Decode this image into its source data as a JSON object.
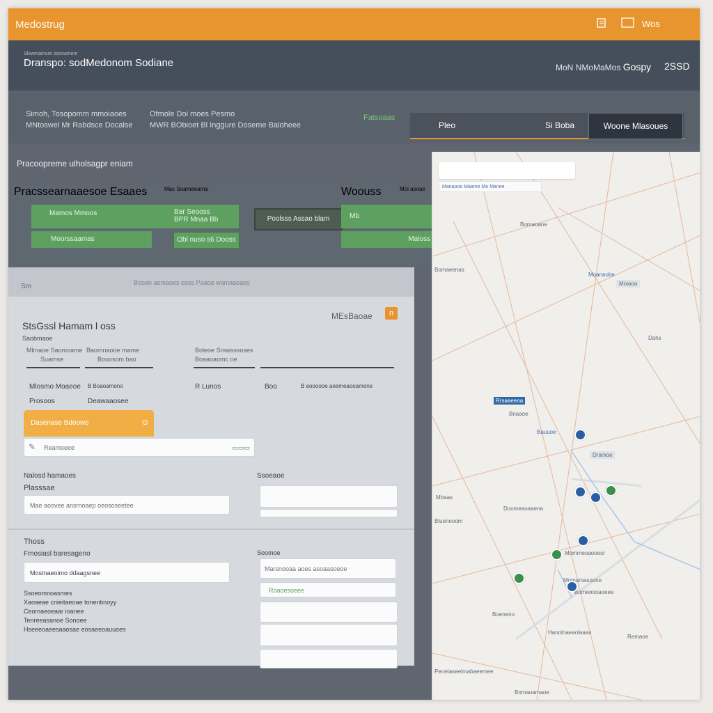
{
  "app": {
    "brand": "Medostrug",
    "topbar_label": "Wos",
    "topbar_icons": [
      "notes-icon",
      "window-icon"
    ]
  },
  "header": {
    "small_text": "Slowmamore ozonamem",
    "title": "Dranspo: sodMedonom Sodiane",
    "meta": "MoN NMoMaMos",
    "meta_value": "Gospy",
    "number": "2SSD"
  },
  "subheader": {
    "col1": [
      "Simoh, Tosopomm mmoiaoes",
      "MNtoswel Mr Rabdsce Docalse"
    ],
    "col2": [
      "Ofmole Doi moes Pesmo",
      "MWR BObioet Bl Inggure Doseme Baloheee"
    ],
    "status": "Fatsoaas"
  },
  "tabs": [
    "Pleo",
    "Si Boba",
    "Woone  Mlasoues"
  ],
  "section": {
    "title": "Pracoopreme ulholsagpr eniam",
    "labels": [
      "Pracssearnaaesoe Esaaes",
      "Mac Soameeama",
      "Woouss",
      "Moi asoae"
    ],
    "btn1": "Mamos Mmoos",
    "btn1_sub": "Moorssaamas",
    "btn2_lines": [
      "Bar Seooss",
      "BPR Mnaa Bb"
    ],
    "btn3": "Obl  nuso  s6  Dooss",
    "btn4": "Poolsss   Assao  blam",
    "btn5": "Mb",
    "btn6": "Maloss"
  },
  "card": {
    "head_left": "Sm",
    "head_right": "Booan  aomaoes  ooss  Paaoe wamaaoaes",
    "heading": "StsGssl Hamam l oss",
    "subheading": "Saobmaoe",
    "right_label": "MEsBaoae",
    "badge": "n",
    "headers": [
      [
        "Mlmaoe  Saomoame",
        "Suamse"
      ],
      [
        "Baomnaooe  mame",
        "Bouosom  bao"
      ],
      [
        "Boleoe  Smaisssoses",
        "Boaaoaomc  oe"
      ]
    ],
    "rows": [
      [
        "Mlosmo  Moaeoe",
        "B  Boaoamono",
        "R Lunos",
        "Boo",
        "B  aoooooe  aoemeaooamene"
      ],
      [
        "Prosoos",
        "Deawaaosee"
      ]
    ],
    "orange_btn": "Dasenase  Bdoows",
    "input1": "Reamoeee",
    "fields": {
      "left_label": "Nalosd hamaoes",
      "left_sub": "Plasssae",
      "left_input": "Mae aoovee  ansrnoaep  oeososeetee",
      "right_label": "Ssoeaoe",
      "section2_label": "Thoss",
      "section2_sub": "Fmosiasl baresageno",
      "section2_input": "Mostnaeoimo  ddaagsnee",
      "right2_label": "Soomoe",
      "right2_input": "Marsnooaa aoes  asoaasoeoe",
      "right3_input": "Roaoesoeee",
      "list": [
        "Ssoeomnoasmes",
        "Xaoaeae  cnieitaeoae  tonentinoyy",
        "Ceomaeoeaar ioanee",
        "Tenreeasanoe  Sonoee",
        "Hseeeoaeesaaosae  eosaeeoauuoes"
      ]
    }
  },
  "map": {
    "chip": "Manaooe  Maame  Mo  Manee",
    "places": [
      "Bomaoane",
      "Bomaeenas",
      "Moanaobe",
      "Moiaoa",
      "Dahs",
      "Rrsaaeeoa",
      "Bnaaoe",
      "Bauuoe",
      "Dramoe",
      "Mbaas",
      "Doomeaoaaena",
      "Blueneoom",
      "Mommeoaooesr",
      "Momamasoone",
      "Bomeoooaoeee",
      "Boeneno",
      "Hanolnaeaolaaas",
      "Remaoe",
      "Peoetaseelmabaeemee",
      "Bomaoamaoe"
    ],
    "pin_colors": [
      "#2b5fa3",
      "#3e8f4c",
      "#2b5fa3",
      "#2b5fa3",
      "#2b5fa3",
      "#3e8f4c",
      "#3e8f4c",
      "#2b5fa3"
    ]
  }
}
